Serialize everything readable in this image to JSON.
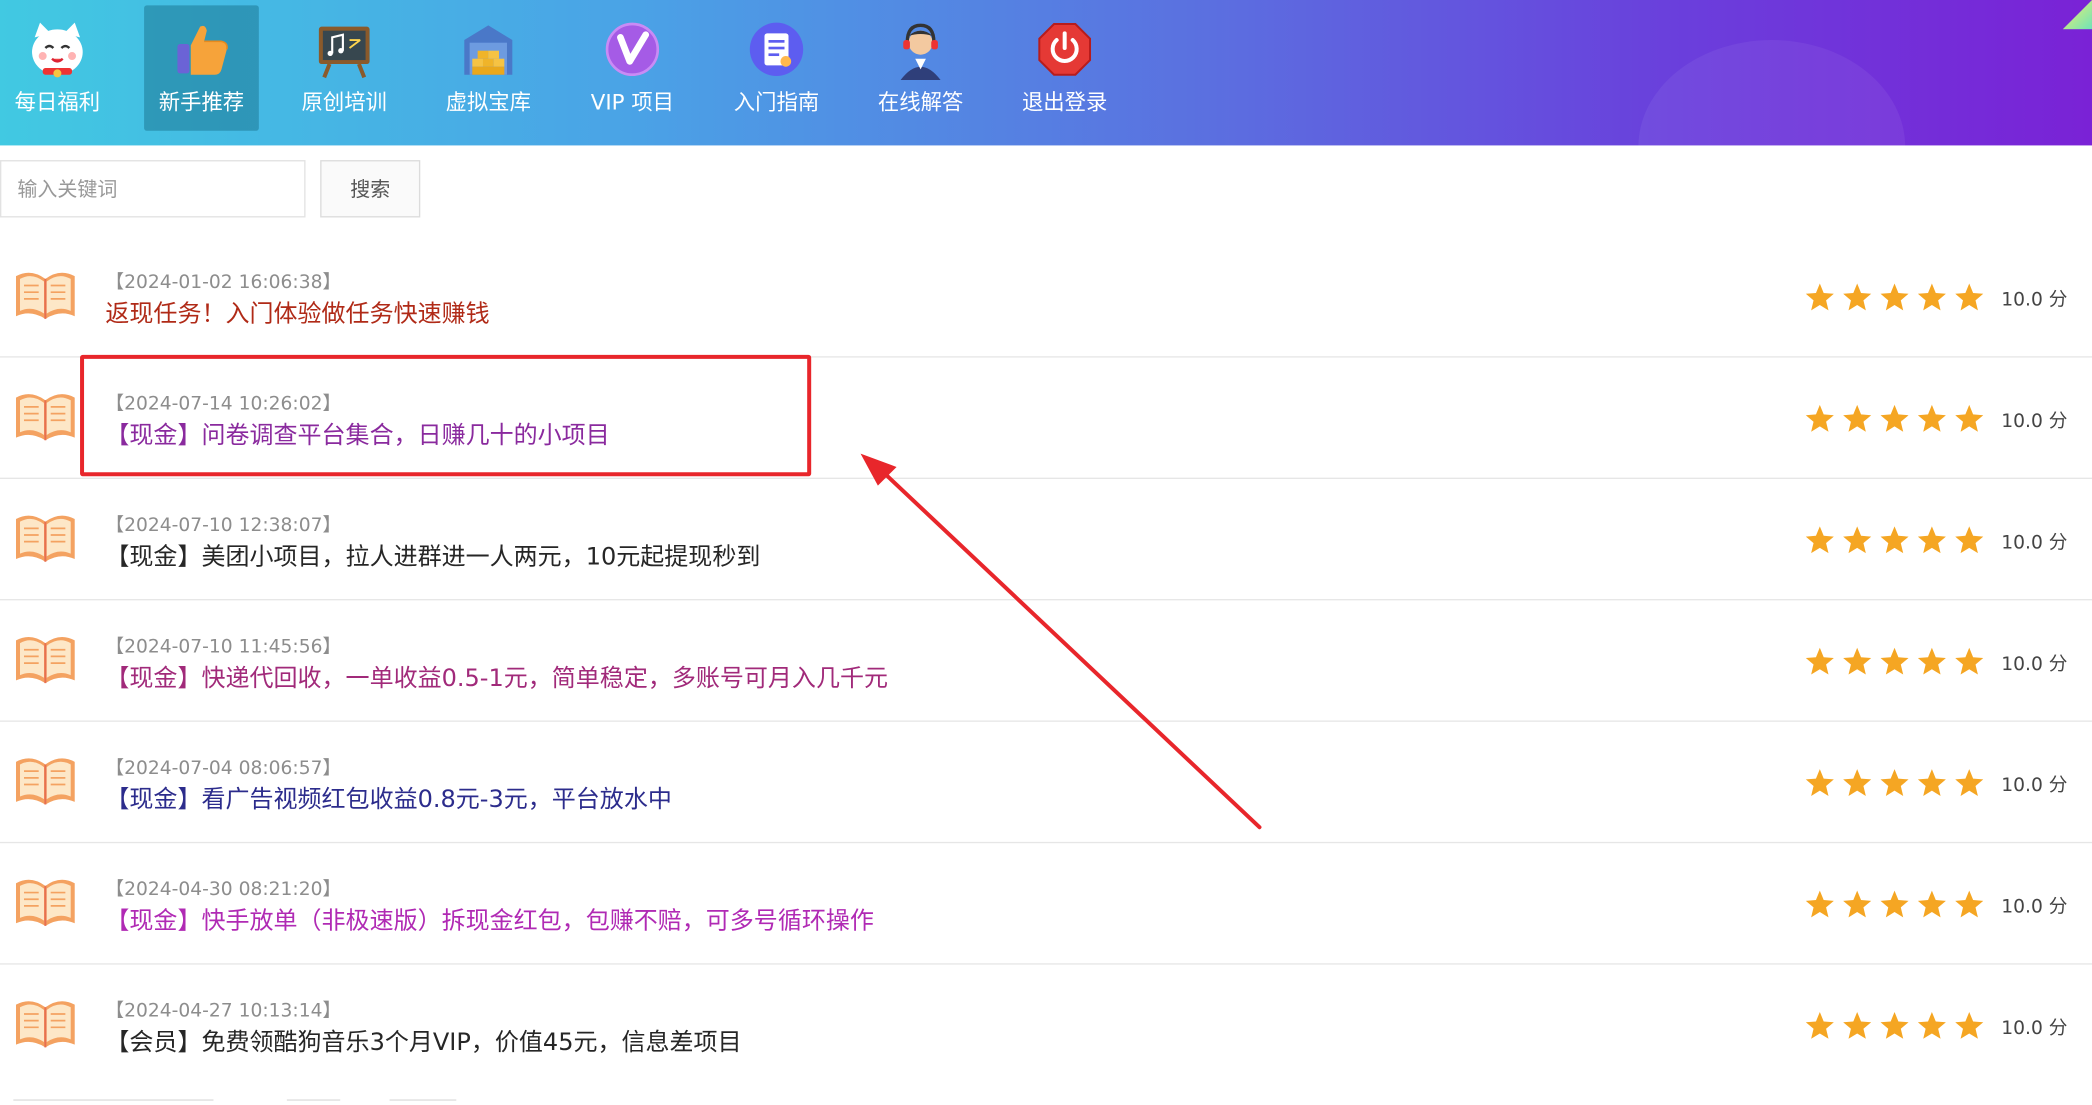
{
  "nav": {
    "items": [
      {
        "label": "每日福利"
      },
      {
        "label": "新手推荐"
      },
      {
        "label": "原创培训"
      },
      {
        "label": "虚拟宝库"
      },
      {
        "label": "VIP 项目"
      },
      {
        "label": "入门指南"
      },
      {
        "label": "在线解答"
      },
      {
        "label": "退出登录"
      }
    ],
    "active_index": 1,
    "gradient_colors": [
      "#41c9e2",
      "#7a22d6"
    ]
  },
  "search": {
    "placeholder": "输入关键词",
    "value": "",
    "button_label": "搜索"
  },
  "articles": [
    {
      "date": "【2024-01-02 16:06:38】",
      "title": "返现任务！入门体验做任务快速赚钱",
      "title_color": "#b02a17",
      "rating": 5,
      "score": "10.0 分"
    },
    {
      "date": "【2024-07-14 10:26:02】",
      "title": "【现金】问卷调查平台集合，日赚几十的小项目",
      "title_color": "#8a2a9e",
      "rating": 5,
      "score": "10.0 分"
    },
    {
      "date": "【2024-07-10 12:38:07】",
      "title": "【现金】美团小项目，拉人进群进一人两元，10元起提现秒到",
      "title_color": "#262626",
      "rating": 5,
      "score": "10.0 分"
    },
    {
      "date": "【2024-07-10 11:45:56】",
      "title": "【现金】快递代回收，一单收益0.5-1元，简单稳定，多账号可月入几千元",
      "title_color": "#a12a7a",
      "rating": 5,
      "score": "10.0 分"
    },
    {
      "date": "【2024-07-04 08:06:57】",
      "title": "【现金】看广告视频红包收益0.8元-3元，平台放水中",
      "title_color": "#2c2c8c",
      "rating": 5,
      "score": "10.0 分"
    },
    {
      "date": "【2024-04-30 08:21:20】",
      "title": "【现金】快手放单（非极速版）拆现金红包，包赚不赔，可多号循环操作",
      "title_color": "#b02ab4",
      "rating": 5,
      "score": "10.0 分"
    },
    {
      "date": "【2024-04-27 10:13:14】",
      "title": "【会员】免费领酷狗音乐3个月VIP，价值45元，信息差项目",
      "title_color": "#262626",
      "rating": 5,
      "score": "10.0 分"
    }
  ],
  "colors": {
    "star": "#f5a623",
    "annotation": "#e8262b",
    "date_text": "#8d8d8d"
  },
  "icons": {
    "nav": [
      "lucky-cat-icon",
      "thumbs-up-icon",
      "chalkboard-icon",
      "treasure-box-icon",
      "vip-badge-icon",
      "guide-document-icon",
      "support-agent-icon",
      "power-off-icon"
    ],
    "row": "open-book-icon",
    "rating": "star-icon"
  }
}
